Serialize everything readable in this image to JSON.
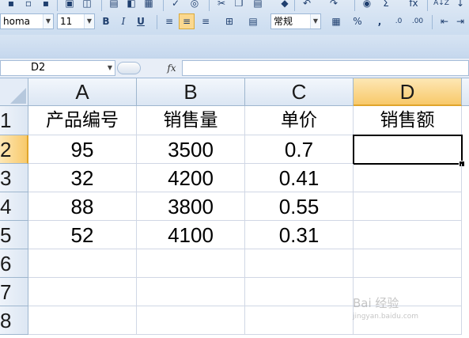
{
  "ribbon": {
    "font_name": "homa",
    "font_size": "11",
    "bold": "B",
    "italic": "I",
    "underline": "U",
    "number_format": "常规",
    "percent": "%",
    "comma": ",",
    "sum_symbol": "Σ",
    "function_symbol": "fx",
    "sort_label": "A↓Z"
  },
  "formula_bar": {
    "name_box": "D2",
    "fx_label": "fx",
    "formula": ""
  },
  "grid": {
    "columns": [
      "A",
      "B",
      "C",
      "D"
    ],
    "rows": [
      "1",
      "2",
      "3",
      "4",
      "5",
      "6",
      "7",
      "8"
    ],
    "header_row": [
      "产品编号",
      "销售量",
      "单价",
      "销售额"
    ],
    "data_rows": [
      [
        "95",
        "3500",
        "0.7",
        ""
      ],
      [
        "32",
        "4200",
        "0.41",
        ""
      ],
      [
        "88",
        "3800",
        "0.55",
        ""
      ],
      [
        "52",
        "4100",
        "0.31",
        ""
      ]
    ],
    "active_cell": "D2"
  },
  "watermark": {
    "text": "Bai 经验",
    "url": "jingyan.baidu.com"
  },
  "colors": {
    "selected_header": "#f8c96a",
    "grid_line": "#d0d7e5",
    "ribbon": "#cfdff1"
  }
}
